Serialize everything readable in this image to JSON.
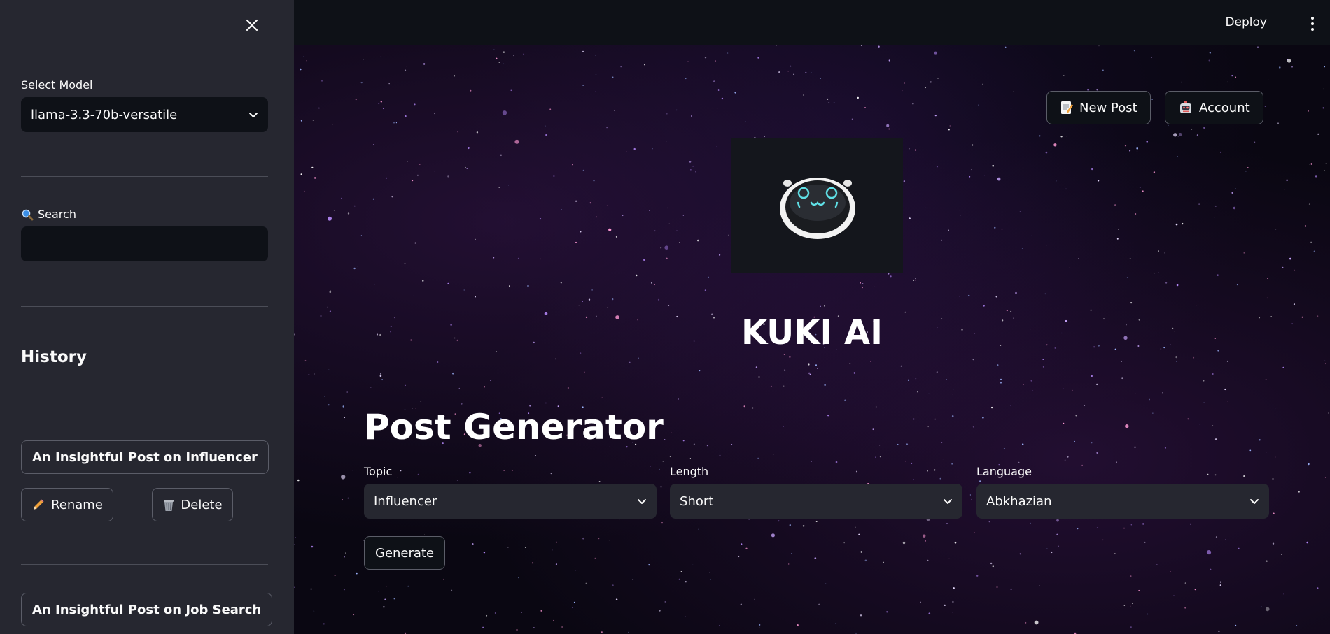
{
  "sidebar": {
    "close_icon": "close-icon",
    "model_label": "Select Model",
    "model_value": "llama-3.3-70b-versatile",
    "search_label": "Search",
    "search_icon": "magnifier-emoji",
    "search_value": "",
    "history_title": "History",
    "history": [
      {
        "title": "An Insightful Post on Influencer",
        "rename_label": "Rename",
        "delete_label": "Delete"
      },
      {
        "title": "An Insightful Post on Job Search"
      }
    ]
  },
  "header": {
    "deploy_label": "Deploy",
    "menu_icon": "kebab-menu-icon"
  },
  "main": {
    "new_post_label": "New Post",
    "account_label": "Account",
    "brand": "KUKI AI",
    "page_title": "Post Generator",
    "fields": {
      "topic": {
        "label": "Topic",
        "value": "Influencer"
      },
      "length": {
        "label": "Length",
        "value": "Short"
      },
      "language": {
        "label": "Language",
        "value": "Abkhazian"
      }
    },
    "generate_label": "Generate"
  },
  "colors": {
    "sidebar_bg": "#262730",
    "app_bg": "#0e1117",
    "text": "#fafafa",
    "border": "#5b5d68"
  }
}
